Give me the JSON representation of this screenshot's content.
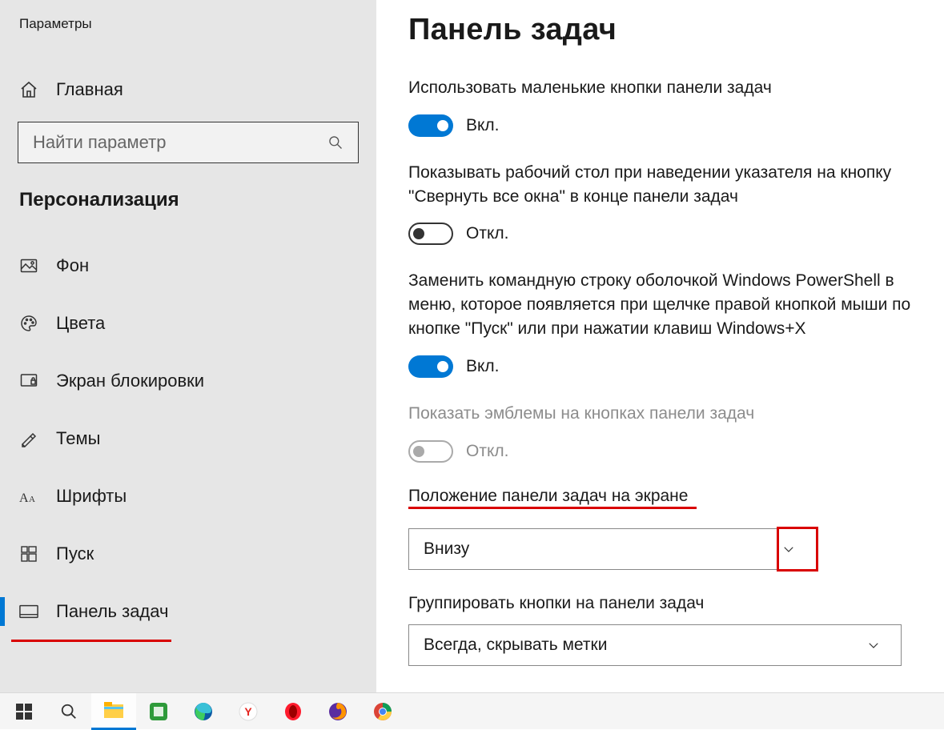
{
  "app_title": "Параметры",
  "sidebar": {
    "home_label": "Главная",
    "search_placeholder": "Найти параметр",
    "category": "Персонализация",
    "items": [
      {
        "label": "Фон"
      },
      {
        "label": "Цвета"
      },
      {
        "label": "Экран блокировки"
      },
      {
        "label": "Темы"
      },
      {
        "label": "Шрифты"
      },
      {
        "label": "Пуск"
      },
      {
        "label": "Панель задач"
      }
    ]
  },
  "main": {
    "title": "Панель задач",
    "settings": {
      "small_buttons": {
        "label": "Использовать маленькие кнопки панели задач",
        "state_label": "Вкл."
      },
      "peek_desktop": {
        "label": "Показывать рабочий стол при наведении указателя на кнопку \"Свернуть все окна\" в конце панели задач",
        "state_label": "Откл."
      },
      "powershell": {
        "label": "Заменить командную строку оболочкой Windows PowerShell в меню, которое появляется при щелчке правой кнопкой мыши по кнопке \"Пуск\" или при нажатии клавиш Windows+X",
        "state_label": "Вкл."
      },
      "badges": {
        "label": "Показать эмблемы на кнопках панели задач",
        "state_label": "Откл."
      },
      "position": {
        "label": "Положение панели задач на экране",
        "value": "Внизу"
      },
      "combine": {
        "label": "Группировать кнопки на панели задач",
        "value": "Всегда, скрывать метки"
      }
    }
  },
  "colors": {
    "accent": "#0078d4",
    "highlight": "#d90000"
  }
}
